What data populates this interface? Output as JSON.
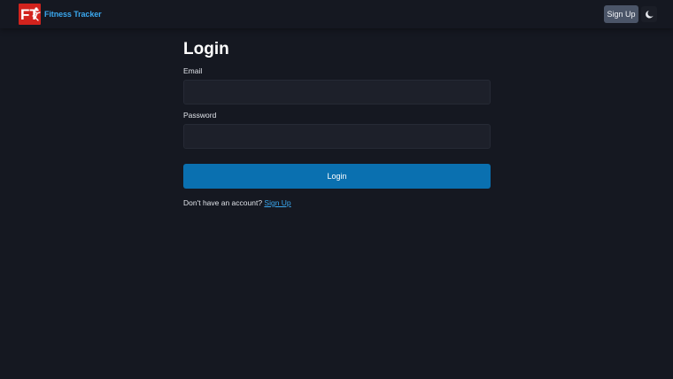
{
  "nav": {
    "brand_name": "Fitness Tracker",
    "logo_text": "FT",
    "signup_label": "Sign Up",
    "theme_icon": "moon-icon"
  },
  "login": {
    "title": "Login",
    "email_label": "Email",
    "email_value": "",
    "password_label": "Password",
    "password_value": "",
    "submit_label": "Login",
    "footer_prompt": "Don't have an account?",
    "footer_link": "Sign Up"
  },
  "colors": {
    "background": "#151821",
    "brand": "#3aa7ee",
    "logo": "#d2231d",
    "primary_button": "#0a70b0",
    "secondary_button": "#4b5568"
  }
}
